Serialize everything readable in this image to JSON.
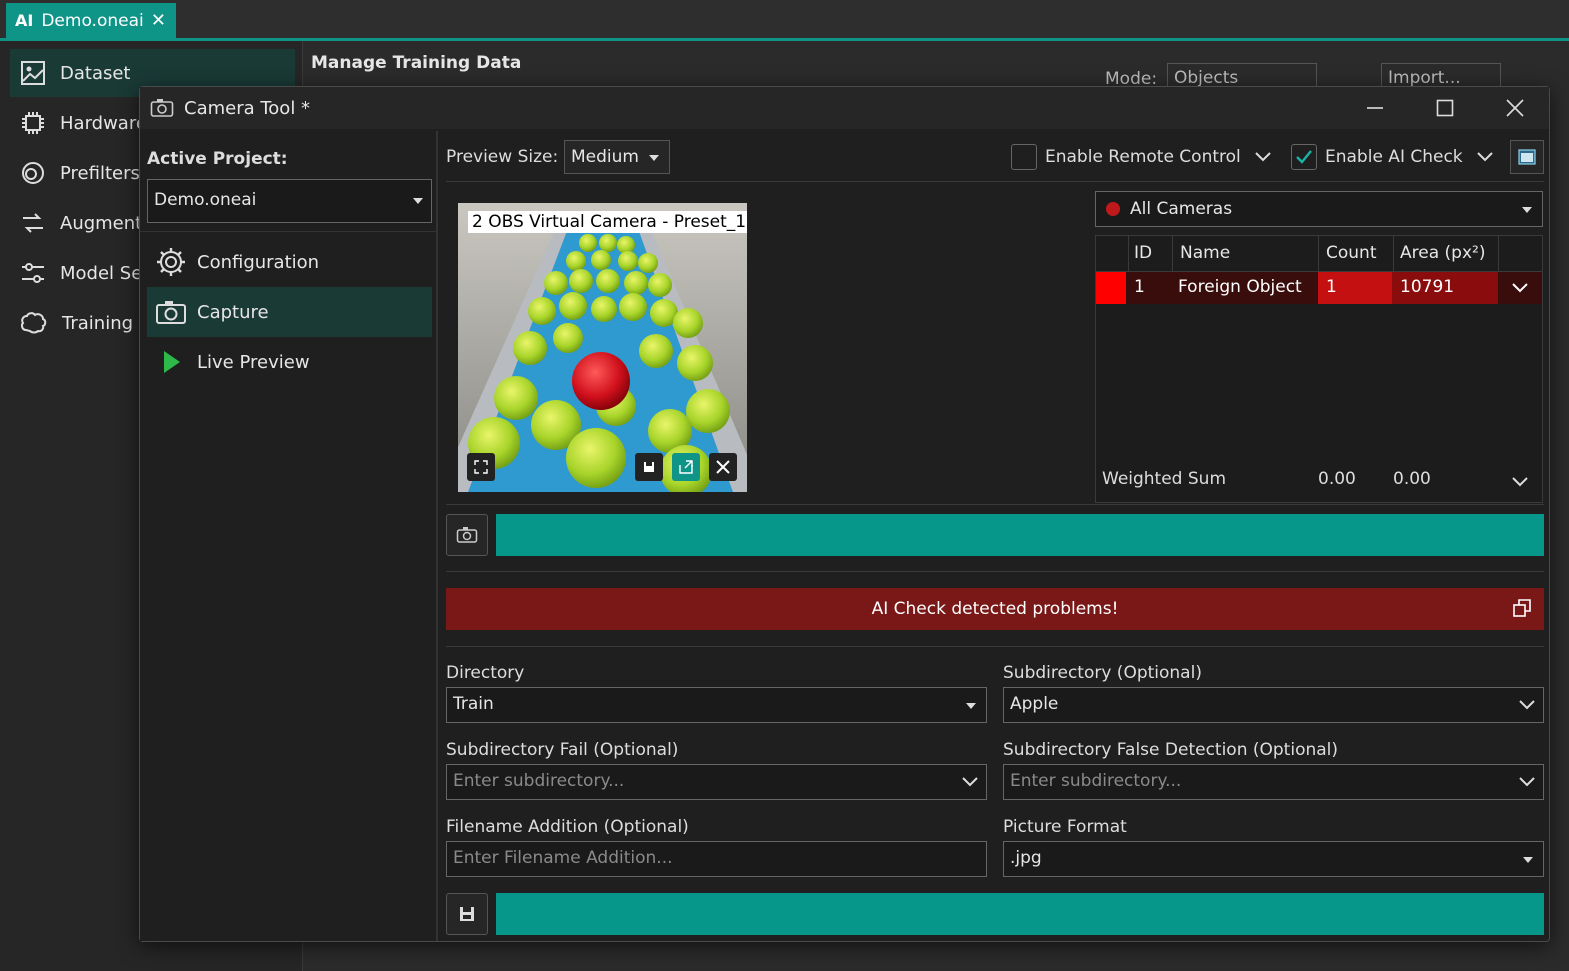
{
  "app": {
    "tab": {
      "ai_badge": "AI",
      "title": "Demo.oneai",
      "close": "✕"
    }
  },
  "leftnav": {
    "items": [
      {
        "label": "Dataset",
        "icon": "image-icon"
      },
      {
        "label": "Hardware",
        "icon": "chip-icon"
      },
      {
        "label": "Prefilters",
        "icon": "filter-icon"
      },
      {
        "label": "Augmentation",
        "icon": "augment-icon"
      },
      {
        "label": "Model Settings",
        "icon": "sliders-icon"
      },
      {
        "label": "Training",
        "icon": "brain-icon"
      }
    ]
  },
  "main": {
    "title": "Manage Training Data",
    "mode_label": "Mode:",
    "mode_value": "Objects",
    "import_label": "Import..."
  },
  "dialog": {
    "title": "Camera Tool *",
    "active_project_label": "Active Project:",
    "active_project_value": "Demo.oneai",
    "nav": [
      {
        "label": "Configuration",
        "icon": "gear-icon"
      },
      {
        "label": "Capture",
        "icon": "camera-icon"
      },
      {
        "label": "Live Preview",
        "icon": "play-icon"
      }
    ],
    "toolbar": {
      "preview_size_label": "Preview Size:",
      "preview_size_value": "Medium",
      "remote_control_label": "Enable Remote Control",
      "remote_control_checked": false,
      "ai_check_label": "Enable AI Check",
      "ai_check_checked": true
    },
    "preview": {
      "camera_label": "2 OBS Virtual Camera - Preset_1"
    },
    "camera_select": "All Cameras",
    "table": {
      "headers": [
        "ID",
        "Name",
        "Count",
        "Area (px²)"
      ],
      "rows": [
        {
          "color": "#ff0000",
          "id": "1",
          "name": "Foreign Object",
          "count": "1",
          "area": "10791"
        }
      ],
      "footer": {
        "label": "Weighted Sum",
        "count": "0.00",
        "area": "0.00"
      }
    },
    "alert": "AI Check detected problems!",
    "form": {
      "directory_label": "Directory",
      "directory_value": "Train",
      "subdir_label": "Subdirectory (Optional)",
      "subdir_value": "Apple",
      "subdir_fail_label": "Subdirectory Fail (Optional)",
      "subdir_fail_placeholder": "Enter subdirectory...",
      "subdir_false_label": "Subdirectory False Detection (Optional)",
      "subdir_false_placeholder": "Enter subdirectory...",
      "filename_label": "Filename Addition (Optional)",
      "filename_placeholder": "Enter Filename Addition...",
      "format_label": "Picture Format",
      "format_value": ".jpg"
    },
    "colors": {
      "accent": "#06968a",
      "alert": "#7a1717",
      "selected": "#1a3a36"
    }
  }
}
